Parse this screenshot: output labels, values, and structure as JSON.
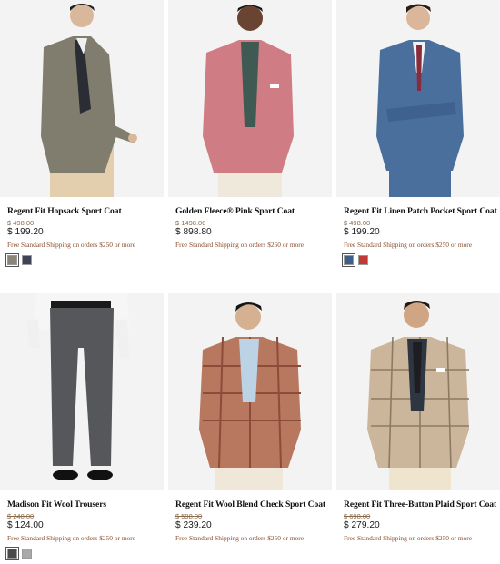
{
  "products": [
    {
      "name": "Regent Fit Hopsack Sport Coat",
      "original_price": "$ 498.00",
      "sale_price": "$ 199.20",
      "promo": "Free Standard Shipping on orders $250 or more",
      "swatches": [
        {
          "label": "grey",
          "color": "#8a8576"
        },
        {
          "label": "navy",
          "color": "#3d4456"
        }
      ]
    },
    {
      "name": "Golden Fleece® Pink Sport Coat",
      "original_price": "$ 1498.00",
      "sale_price": "$ 898.80",
      "promo": "Free Standard Shipping on orders $250 or more",
      "swatches": []
    },
    {
      "name": "Regent Fit Linen Patch Pocket Sport Coat",
      "original_price": "$ 498.00",
      "sale_price": "$ 199.20",
      "promo": "Free Standard Shipping on orders $250 or more",
      "swatches": [
        {
          "label": "blue",
          "color": "#3e5f8a"
        },
        {
          "label": "red",
          "color": "#c23a35"
        }
      ]
    },
    {
      "name": "Madison Fit Wool Trousers",
      "original_price": "$ 248.00",
      "sale_price": "$ 124.00",
      "promo": "Free Standard Shipping on orders $250 or more",
      "swatches": [
        {
          "label": "charcoal",
          "color": "#4a4a4a"
        },
        {
          "label": "light grey",
          "color": "#a9a9a9"
        }
      ]
    },
    {
      "name": "Regent Fit Wool Blend Check Sport Coat",
      "original_price": "$ 598.00",
      "sale_price": "$ 239.20",
      "promo": "Free Standard Shipping on orders $250 or more",
      "swatches": []
    },
    {
      "name": "Regent Fit Three-Button Plaid Sport Coat",
      "original_price": "$ 698.00",
      "sale_price": "$ 279.20",
      "promo": "Free Standard Shipping on orders $250 or more",
      "swatches": []
    }
  ],
  "colors": {
    "promo_text": "#8a4a2a",
    "strikethrough_price": "#8a6a4a"
  }
}
